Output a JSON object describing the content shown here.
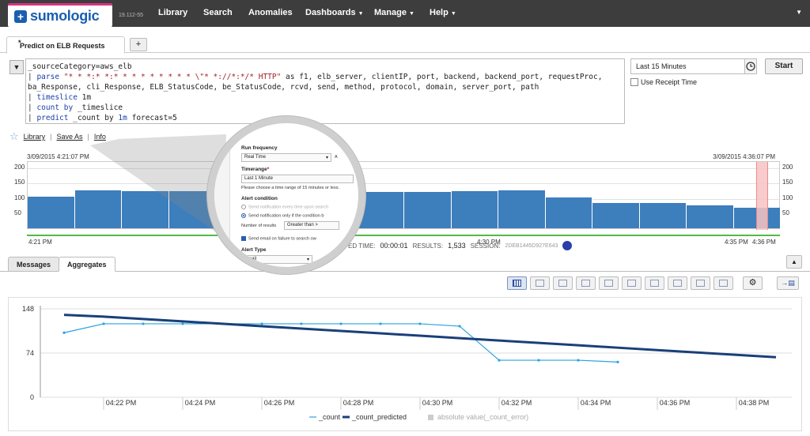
{
  "header": {
    "logo_mark": "+",
    "logo_text": "sumologic",
    "version": "19.112-55",
    "nav": [
      {
        "label": "Library",
        "caret": false
      },
      {
        "label": "Search",
        "caret": false
      },
      {
        "label": "Anomalies",
        "caret": false
      },
      {
        "label": "Dashboards",
        "caret": true
      },
      {
        "label": "Manage",
        "caret": true
      },
      {
        "label": "Help",
        "caret": true
      }
    ],
    "caret_glyph": "▼"
  },
  "tabs": {
    "active_label": "Predict on ELB Requests",
    "modified_marker": "*",
    "add_label": "+"
  },
  "query": {
    "toggle": "▼",
    "lines": [
      {
        "parts": [
          {
            "t": "_sourceCategory=aws_elb",
            "c": ""
          }
        ]
      },
      {
        "parts": [
          {
            "t": "| ",
            "c": "q-pipe"
          },
          {
            "t": "parse ",
            "c": "q-kw"
          },
          {
            "t": "\"* * *:* *:* * * * * * * * * \\\"* *://*:*/* HTTP\"",
            "c": "q-str"
          },
          {
            "t": " as f1, elb_server, clientIP, port, backend, backend_port, requestProc,",
            "c": ""
          }
        ]
      },
      {
        "parts": [
          {
            "t": "ba_Response, cli_Response, ELB_StatusCode, be_StatusCode, rcvd, send, method, protocol, domain, server_port, path",
            "c": ""
          }
        ]
      },
      {
        "parts": [
          {
            "t": "| ",
            "c": "q-pipe"
          },
          {
            "t": "timeslice ",
            "c": "q-kw"
          },
          {
            "t": "1m",
            "c": ""
          }
        ]
      },
      {
        "parts": [
          {
            "t": "| ",
            "c": "q-pipe"
          },
          {
            "t": "count by ",
            "c": "q-kw"
          },
          {
            "t": "_timeslice",
            "c": ""
          }
        ]
      },
      {
        "parts": [
          {
            "t": "| ",
            "c": "q-pipe"
          },
          {
            "t": "predict ",
            "c": "q-kw"
          },
          {
            "t": "_count by ",
            "c": ""
          },
          {
            "t": "1m ",
            "c": "q-kw"
          },
          {
            "t": "forecast=5",
            "c": ""
          }
        ]
      }
    ]
  },
  "timerange": {
    "value": "Last 15 Minutes",
    "start_label": "Start",
    "receipt_label": "Use Receipt Time"
  },
  "links": {
    "library": "Library",
    "save_as": "Save As",
    "info": "Info",
    "sep": "|"
  },
  "histogram": {
    "start_date": "3/09/2015 4:21:07 PM",
    "end_date": "3/09/2015 4:36:07 PM",
    "yticks": [
      200,
      150,
      100,
      50
    ],
    "ymax": 220,
    "bars": [
      103,
      125,
      121,
      120,
      119,
      120,
      120,
      120,
      120,
      120,
      122,
      119,
      118,
      117,
      118,
      119,
      120,
      118,
      122,
      110,
      90,
      82,
      82,
      82,
      82,
      82,
      82,
      80,
      70,
      70,
      62
    ],
    "xticks": [
      "4:21 PM",
      "4:30 PM",
      "4:35 PM",
      "4:36 PM"
    ]
  },
  "status": {
    "elapsed_label": "ED TIME:",
    "elapsed": "00:00:01",
    "results_label": "RESULTS:",
    "results": "1,533",
    "session_label": "SESSION:",
    "session": "2DEB1445D927E643"
  },
  "result_tabs": {
    "messages": "Messages",
    "aggregates": "Aggregates",
    "collapse": "▲"
  },
  "toolbar": {
    "tools": [
      "table-icon",
      "bar-chart-icon",
      "column-chart-icon",
      "line-chart-icon",
      "area-chart-icon",
      "pie-chart-icon",
      "map-icon",
      "single-value-icon",
      "box-plot-icon",
      "combo-chart-icon"
    ],
    "gear": "⚙",
    "export": "→▤"
  },
  "chart_data": {
    "type": "line",
    "x": [
      "04:21 PM",
      "04:22 PM",
      "04:23 PM",
      "04:24 PM",
      "04:25 PM",
      "04:26 PM",
      "04:27 PM",
      "04:28 PM",
      "04:29 PM",
      "04:30 PM",
      "04:31 PM",
      "04:32 PM",
      "04:33 PM",
      "04:34 PM",
      "04:35 PM",
      "04:36 PM",
      "04:37 PM",
      "04:38 PM",
      "04:39 PM"
    ],
    "xticks": [
      "04:22 PM",
      "04:24 PM",
      "04:26 PM",
      "04:28 PM",
      "04:30 PM",
      "04:32 PM",
      "04:34 PM",
      "04:36 PM",
      "04:38 PM"
    ],
    "yticks": [
      0,
      74,
      148
    ],
    "ylim": [
      0,
      148
    ],
    "series": [
      {
        "name": "_count",
        "color": "#29a3e0",
        "values": [
          108,
          123,
          123,
          123,
          123,
          123,
          123,
          123,
          123,
          123,
          119,
          62,
          62,
          62,
          59,
          null,
          null,
          null,
          null
        ]
      },
      {
        "name": "_count_predicted",
        "color": "#1a3f7a",
        "values": [
          138,
          135,
          131,
          127,
          123,
          119,
          115,
          111,
          107,
          103,
          99,
          95,
          91,
          87,
          83,
          79,
          75,
          71,
          67
        ]
      },
      {
        "name": "absolute value(_count_error)",
        "color": "#cccccc",
        "values": []
      }
    ],
    "legend_position": "bottom"
  },
  "magnifier": {
    "run_frequency_label": "Run frequency",
    "run_frequency_value": "Real Time",
    "run_frequency_extra": "A",
    "timerange_label": "Timerange",
    "required_marker": "*",
    "timerange_value": "Last 1 Minute",
    "timerange_help": "Please choose a time range of 15 minutes or less.",
    "alert_condition_label": "Alert condition",
    "option_every_time": "Send notification every time upon search",
    "option_condition": "Send notification only if the condition b",
    "results_count_label": "Number of results",
    "results_count_value": "Greater than >",
    "email_failure_label": "Send email on failure to search ow",
    "alert_type_label": "Alert Type",
    "alert_type_value": "Email"
  }
}
